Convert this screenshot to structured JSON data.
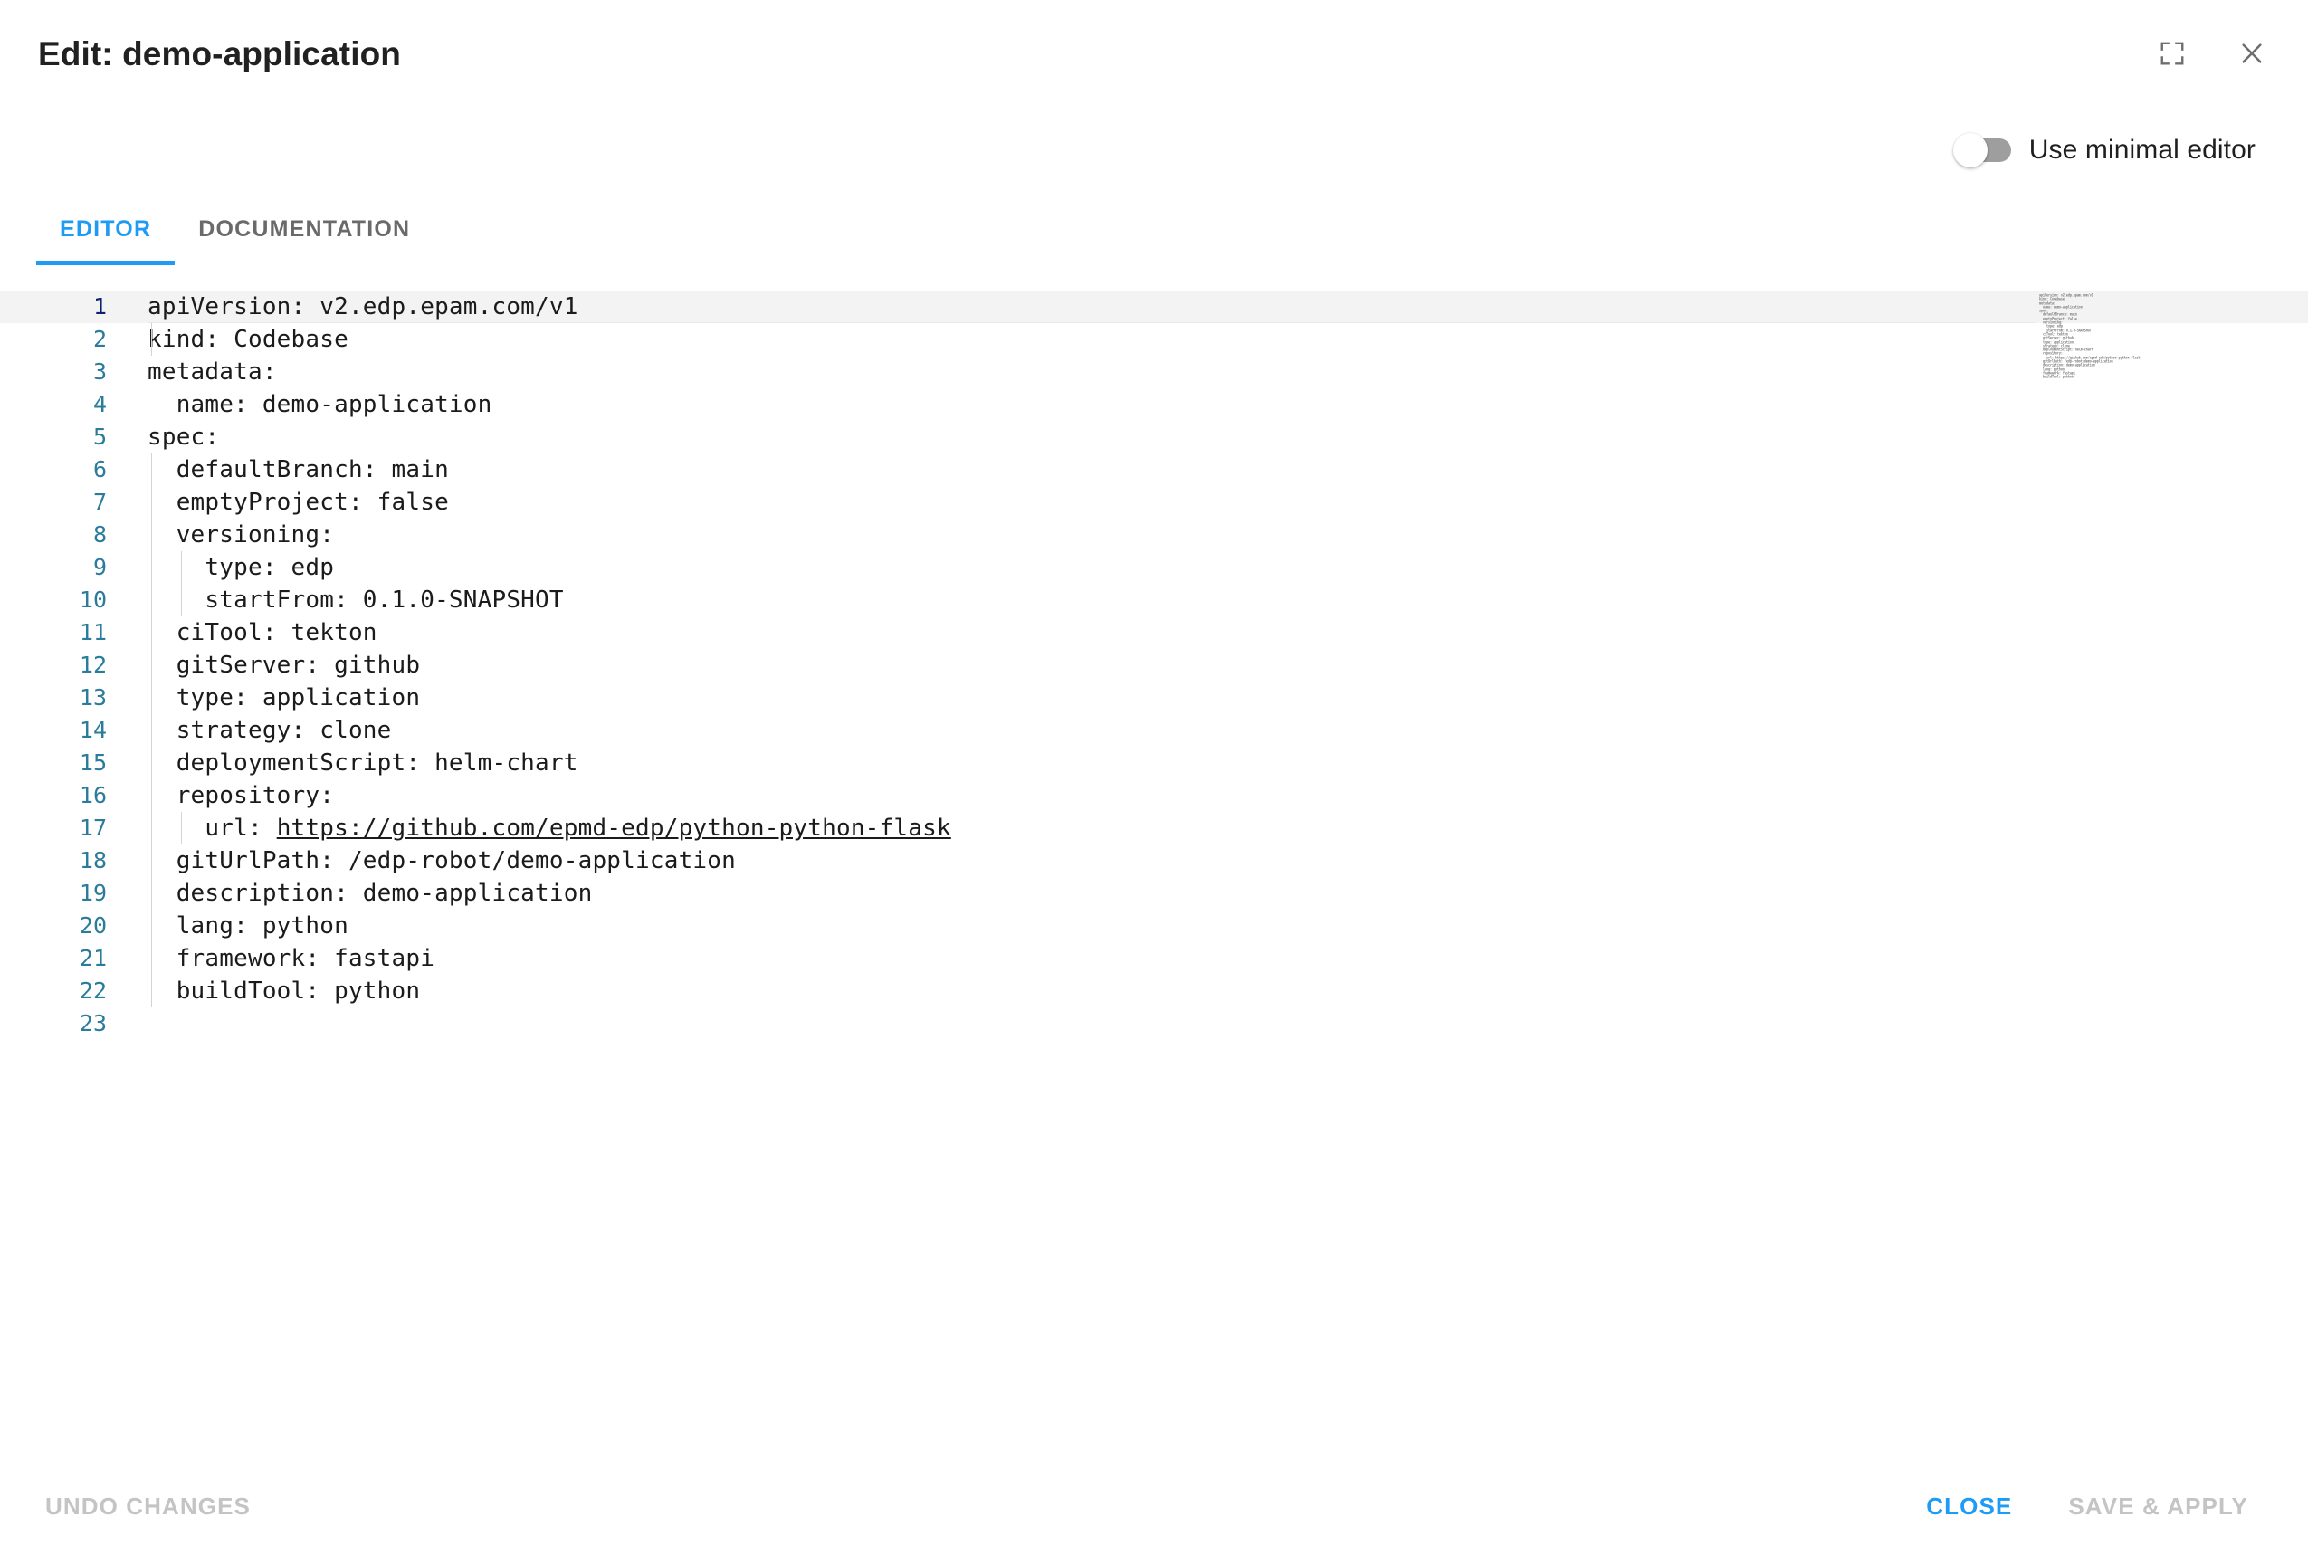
{
  "dialog": {
    "title": "Edit: demo-application",
    "fullscreen_icon": "fullscreen-icon",
    "close_icon": "close-icon"
  },
  "toggle": {
    "label": "Use minimal editor",
    "checked": false
  },
  "tabs": [
    {
      "label": "EDITOR",
      "active": true
    },
    {
      "label": "DOCUMENTATION",
      "active": false
    }
  ],
  "editor": {
    "active_line": 1,
    "total_lines": 23,
    "link_url": "https://github.com/epmd-edp/python-python-flask",
    "lines": [
      {
        "n": "1",
        "text": "apiVersion: v2.edp.epam.com/v1"
      },
      {
        "n": "2",
        "text": "kind: Codebase"
      },
      {
        "n": "3",
        "text": "metadata:"
      },
      {
        "n": "4",
        "text": "  name: demo-application"
      },
      {
        "n": "5",
        "text": "spec:"
      },
      {
        "n": "6",
        "text": "  defaultBranch: main"
      },
      {
        "n": "7",
        "text": "  emptyProject: false"
      },
      {
        "n": "8",
        "text": "  versioning:"
      },
      {
        "n": "9",
        "text": "    type: edp"
      },
      {
        "n": "10",
        "text": "    startFrom: 0.1.0-SNAPSHOT"
      },
      {
        "n": "11",
        "text": "  ciTool: tekton"
      },
      {
        "n": "12",
        "text": "  gitServer: github"
      },
      {
        "n": "13",
        "text": "  type: application"
      },
      {
        "n": "14",
        "text": "  strategy: clone"
      },
      {
        "n": "15",
        "text": "  deploymentScript: helm-chart"
      },
      {
        "n": "16",
        "text": "  repository:"
      },
      {
        "n": "17",
        "text": "    url: ",
        "link": "https://github.com/epmd-edp/python-python-flask"
      },
      {
        "n": "18",
        "text": "  gitUrlPath: /edp-robot/demo-application"
      },
      {
        "n": "19",
        "text": "  description: demo-application"
      },
      {
        "n": "20",
        "text": "  lang: python"
      },
      {
        "n": "21",
        "text": "  framework: fastapi"
      },
      {
        "n": "22",
        "text": "  buildTool: python"
      },
      {
        "n": "23",
        "text": ""
      }
    ]
  },
  "footer": {
    "undo_label": "UNDO CHANGES",
    "close_label": "CLOSE",
    "save_label": "SAVE & APPLY"
  },
  "colors": {
    "accent": "#1e9bf5",
    "line_number": "#2b7c9b",
    "active_line_number": "#0b216f",
    "disabled_text": "#c4c4c4",
    "current_line_bg": "#f3f3f3"
  }
}
